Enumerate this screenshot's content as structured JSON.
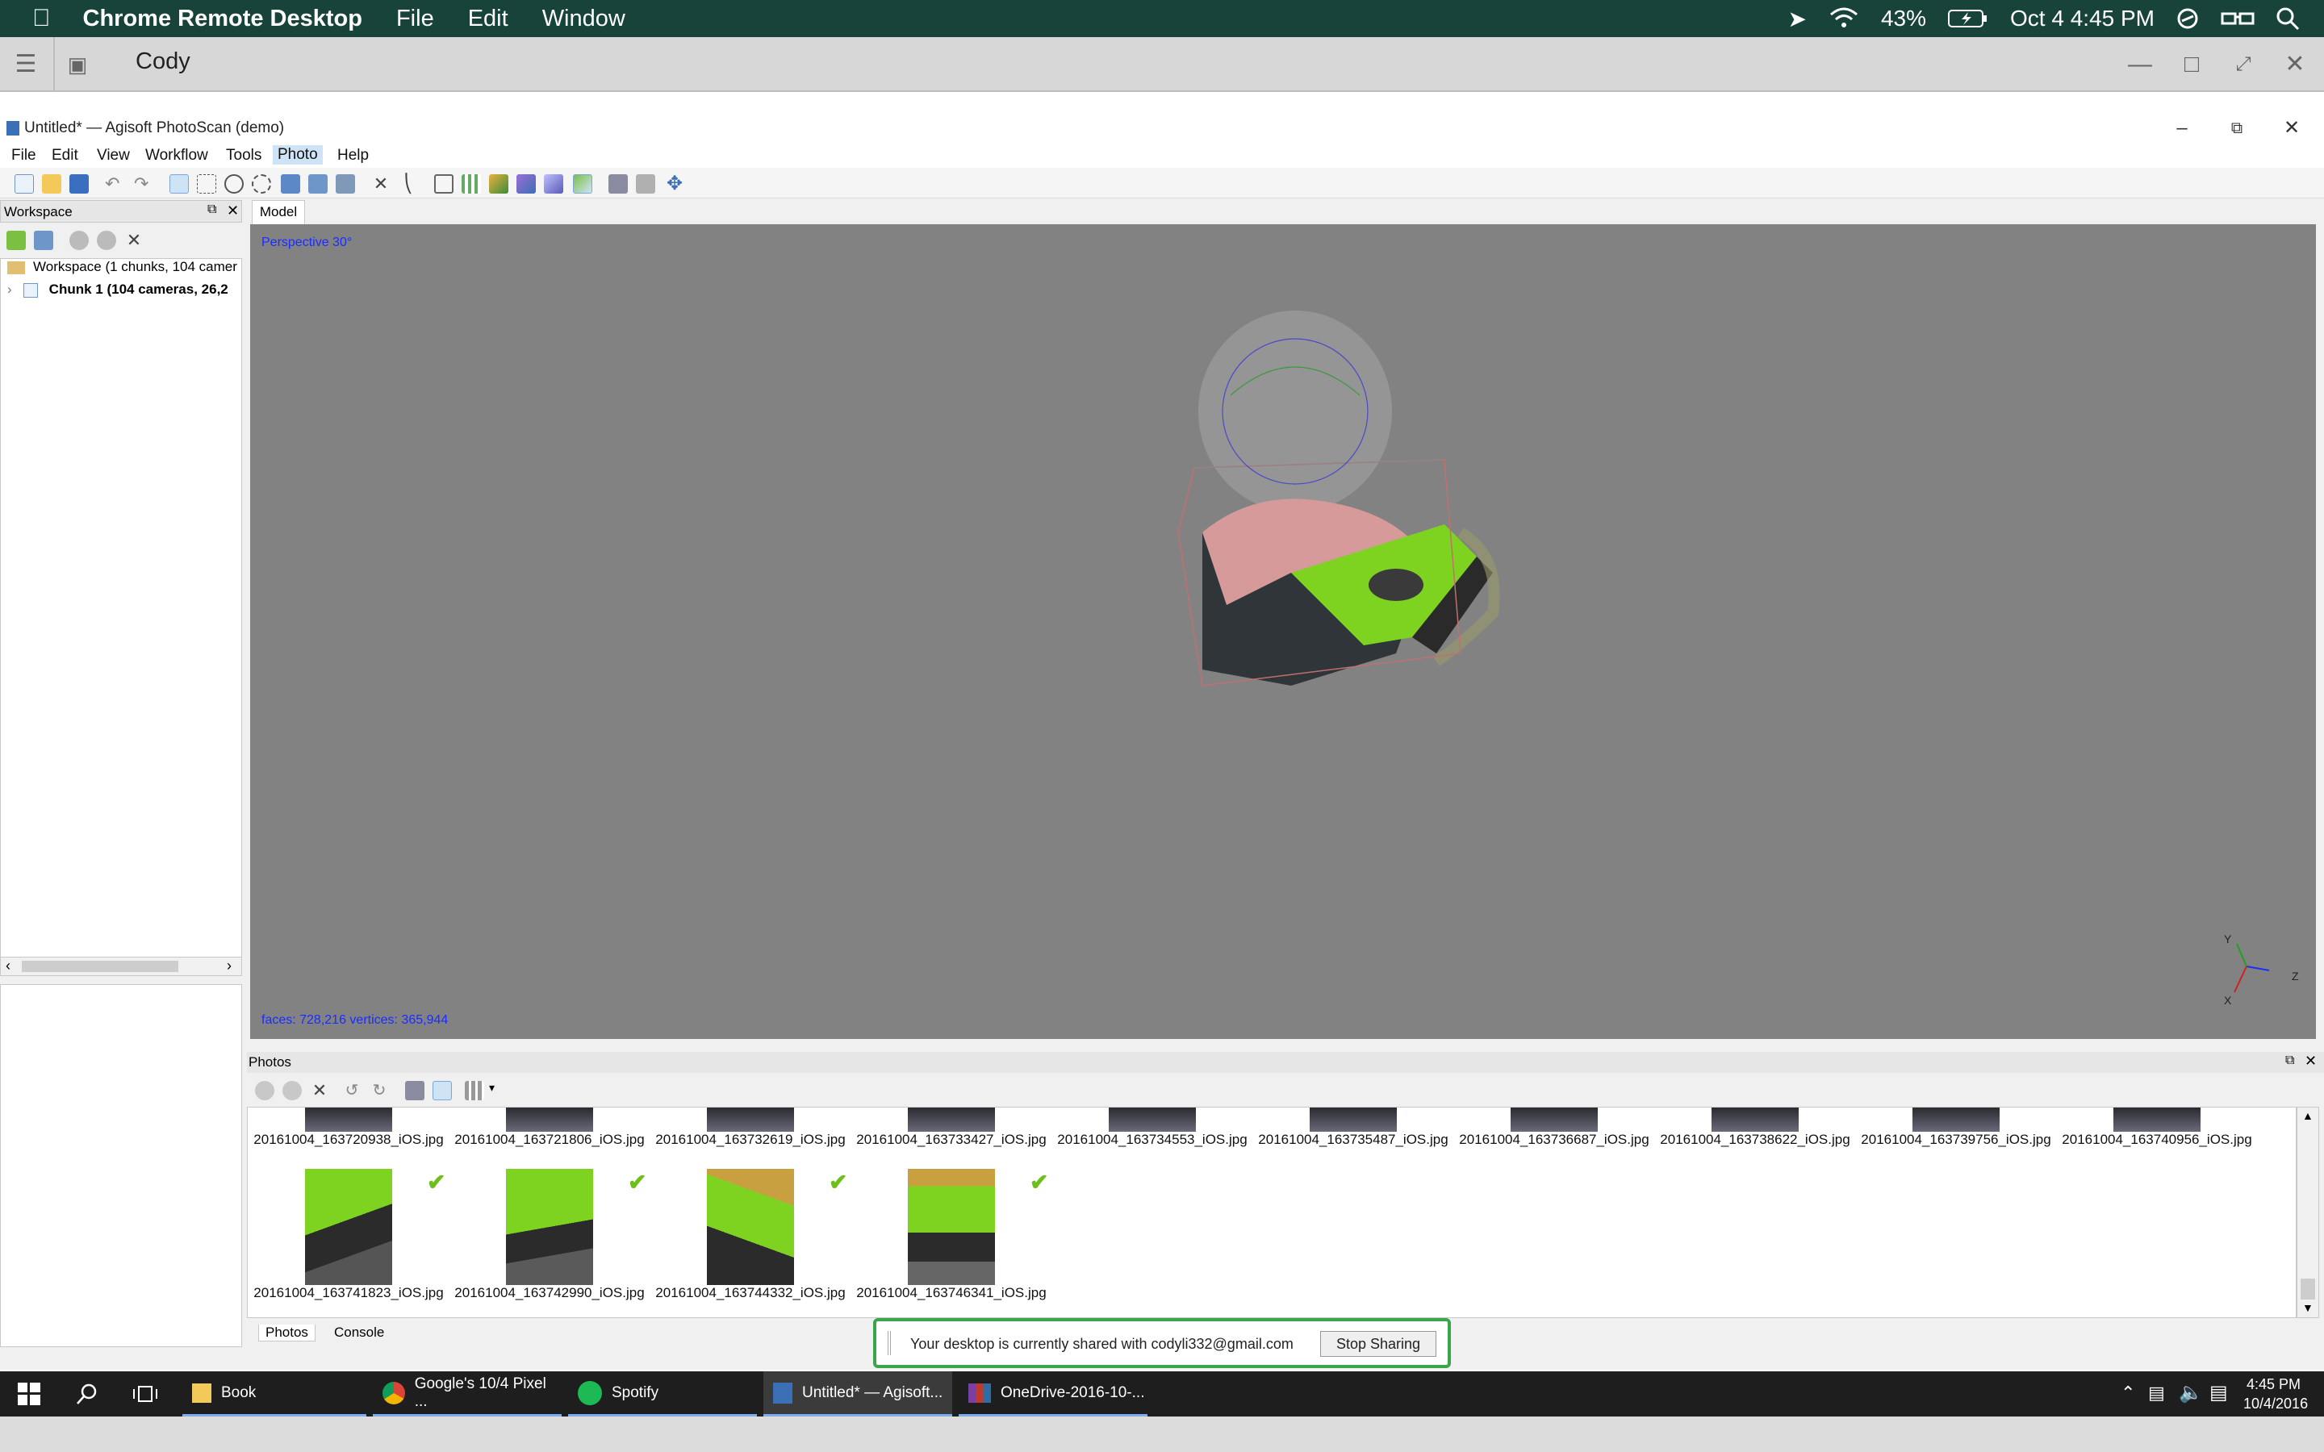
{
  "mac_menubar": {
    "app_name": "Chrome Remote Desktop",
    "menus": [
      "File",
      "Edit",
      "Window"
    ],
    "battery": "43%",
    "datetime": "Oct 4  4:45 PM"
  },
  "crd_bar": {
    "title": "Cody"
  },
  "photoscan": {
    "window_title": "Untitled* — Agisoft PhotoScan (demo)",
    "menus": [
      "File",
      "Edit",
      "View",
      "Workflow",
      "Tools",
      "Photo",
      "Help"
    ],
    "workspace": {
      "header": "Workspace",
      "root": "Workspace (1 chunks, 104 camer",
      "chunk": "Chunk 1 (104 cameras, 26,2"
    },
    "model": {
      "tab": "Model",
      "projection": "Perspective 30°",
      "stats": "faces: 728,216 vertices: 365,944",
      "axes": {
        "x": "X",
        "y": "Y",
        "z": "Z"
      }
    },
    "photos": {
      "header": "Photos",
      "row1": [
        "20161004_163720938_iOS.jpg",
        "20161004_163721806_iOS.jpg",
        "20161004_163732619_iOS.jpg",
        "20161004_163733427_iOS.jpg",
        "20161004_163734553_iOS.jpg",
        "20161004_163735487_iOS.jpg",
        "20161004_163736687_iOS.jpg",
        "20161004_163738622_iOS.jpg",
        "20161004_163739756_iOS.jpg",
        "20161004_163740956_iOS.jpg"
      ],
      "row2": [
        "20161004_163741823_iOS.jpg",
        "20161004_163742990_iOS.jpg",
        "20161004_163744332_iOS.jpg",
        "20161004_163746341_iOS.jpg"
      ],
      "tabs": [
        "Photos",
        "Console"
      ]
    }
  },
  "share_banner": {
    "message": "Your desktop is currently shared with codyli332@gmail.com",
    "button": "Stop Sharing"
  },
  "taskbar": {
    "items": [
      "Book",
      "Google's 10/4 Pixel ...",
      "Spotify",
      "Untitled* — Agisoft...",
      "OneDrive-2016-10-..."
    ],
    "time": "4:45 PM",
    "date": "10/4/2016"
  },
  "colors": {
    "mac_bar": "#17433b",
    "viewport": "#828282",
    "share_border": "#3aa54a",
    "taskbar": "#1e1e1e"
  }
}
